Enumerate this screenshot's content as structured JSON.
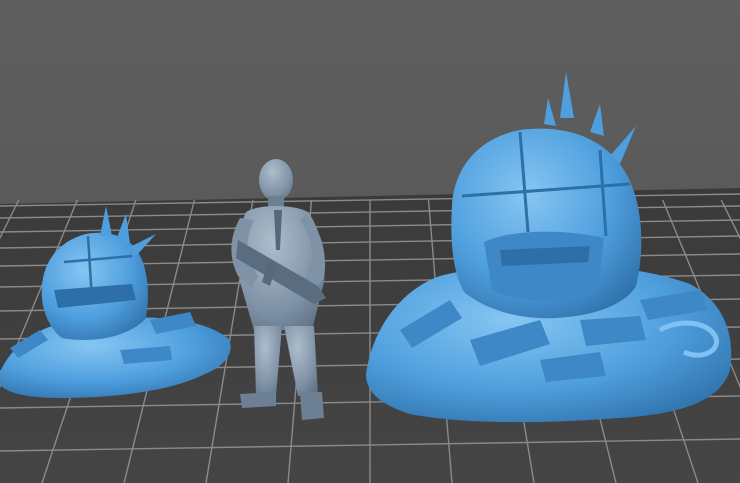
{
  "scene": {
    "colors": {
      "background": "#5d5d5d",
      "bed": "#3f3f3f",
      "grid_line": "#8a8a8a",
      "model_blue": "#4f9fde",
      "model_blue_dark": "#2d6fa8",
      "model_blue_light": "#7fc1f0",
      "figure_gray": "#7f92a6",
      "figure_dark": "#56687c",
      "figure_light": "#a7b7c8"
    },
    "objects": [
      {
        "name": "small-wrecked-mech-head-model",
        "color": "model_blue"
      },
      {
        "name": "human-figure-with-gun-model",
        "color": "figure_gray"
      },
      {
        "name": "large-wrecked-mech-head-model",
        "color": "model_blue"
      }
    ]
  }
}
